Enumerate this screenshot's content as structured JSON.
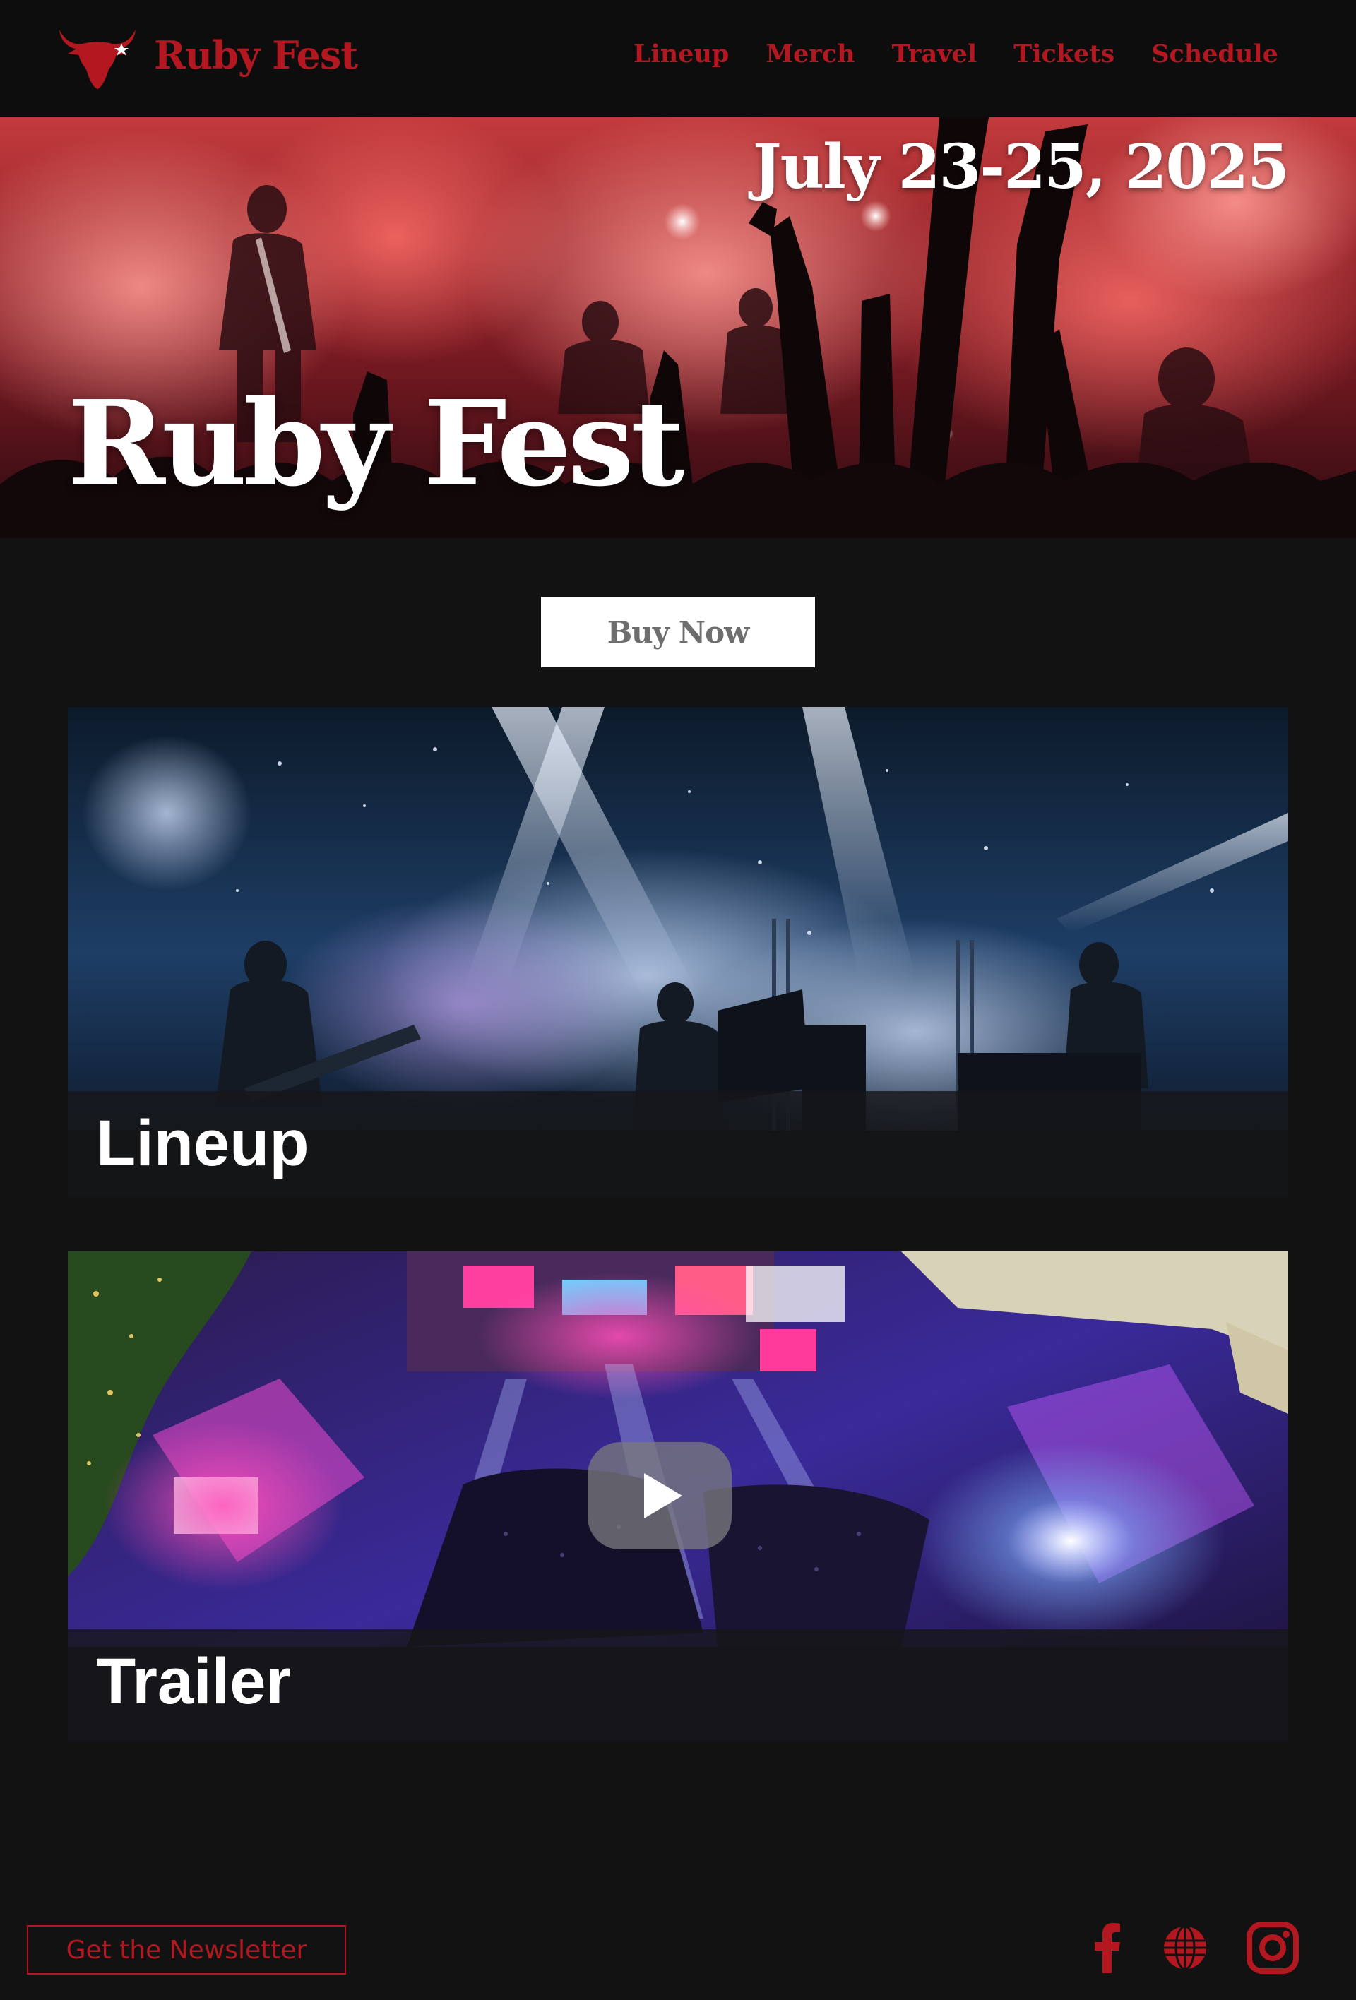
{
  "header": {
    "brand_name": "Ruby Fest",
    "logo_icon": "bull-head-logo-icon",
    "nav": [
      {
        "label": "Lineup"
      },
      {
        "label": "Merch"
      },
      {
        "label": "Travel"
      },
      {
        "label": "Tickets"
      },
      {
        "label": "Schedule"
      }
    ]
  },
  "hero": {
    "date": "July 23-25, 2025",
    "title": "Ruby Fest",
    "background": "concert-crowd-red-photo"
  },
  "cta": {
    "buy_label": "Buy Now"
  },
  "cards": {
    "lineup": {
      "title": "Lineup",
      "image": "band-on-stage-blue-lights-photo"
    },
    "trailer": {
      "title": "Trailer",
      "image": "aerial-festival-stages-night-photo",
      "play_icon": "play-icon"
    }
  },
  "footer": {
    "newsletter_label": "Get the Newsletter",
    "social_icons": [
      "facebook-icon",
      "globe-icon",
      "instagram-icon"
    ]
  },
  "colors": {
    "brand_red": "#b3171f",
    "page_background": "#121212",
    "header_background": "#0d0d0d",
    "button_background": "#ffffff",
    "button_text": "#6e6e6e"
  }
}
